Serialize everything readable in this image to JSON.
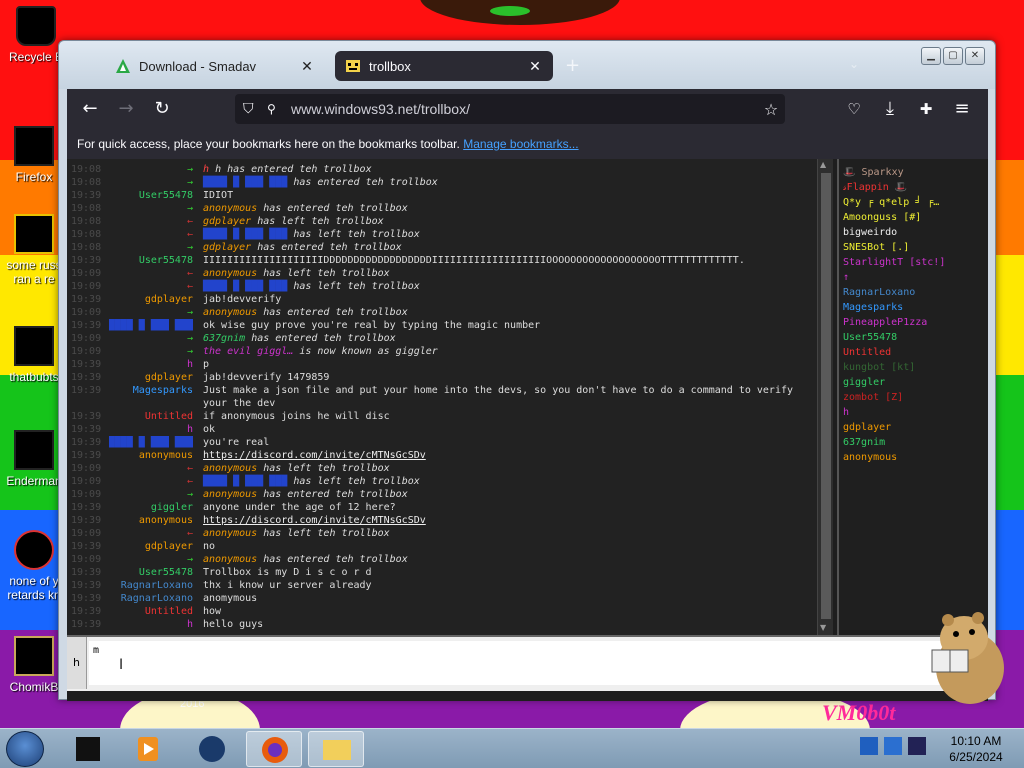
{
  "desktop": {
    "icons": [
      {
        "label": "Recycle B"
      },
      {
        "label": "Firefox"
      },
      {
        "label": "some russ",
        "label2": "ran a re"
      },
      {
        "label": "thatbubts"
      },
      {
        "label": "Enderman"
      },
      {
        "label": "none of y",
        "label2": "retards kn"
      },
      {
        "label": "ChomikB"
      }
    ],
    "bottom_number": "2016",
    "watermark": "VM0b0t"
  },
  "browser": {
    "tabs": [
      {
        "label": "Download - Smadav",
        "icon": "smadav-icon",
        "close": "✕"
      },
      {
        "label": "trollbox",
        "icon": "trollbox-icon",
        "close": "✕"
      }
    ],
    "new_tab": "+",
    "url": "www.windows93.net/trollbox/",
    "bookmarks_text": "For quick access, place your bookmarks here on the bookmarks toolbar.",
    "bookmarks_link": "Manage bookmarks..."
  },
  "trollbox": {
    "messages": [
      {
        "time": "19:08",
        "nick": "→",
        "nick_color": "#3c3",
        "text": "h has entered teh trollbox",
        "text_color": "#ddd",
        "sys": true,
        "prefix": "h",
        "prefix_color": "#f44"
      },
      {
        "time": "19:08",
        "nick": "→",
        "nick_color": "#3c3",
        "text": "has entered teh trollbox",
        "text_color": "#ddd",
        "sys": true,
        "prefix": "████ █ ███ ███",
        "prefix_color": "#24c"
      },
      {
        "time": "19:39",
        "nick": "User55478",
        "nick_color": "#3c6",
        "text": "IDIOT",
        "text_color": "#ddd",
        "sys": false
      },
      {
        "time": "19:08",
        "nick": "→",
        "nick_color": "#3c3",
        "text": "has entered teh trollbox",
        "text_color": "#ddd",
        "sys": true,
        "prefix": "anonymous",
        "prefix_color": "#e90"
      },
      {
        "time": "19:08",
        "nick": "←",
        "nick_color": "#c33",
        "text": "has left teh trollbox",
        "text_color": "#ddd",
        "sys": true,
        "prefix": "gdplayer",
        "prefix_color": "#e90"
      },
      {
        "time": "19:08",
        "nick": "←",
        "nick_color": "#c33",
        "text": "has left teh trollbox",
        "text_color": "#ddd",
        "sys": true,
        "prefix": "████ █ ███ ███",
        "prefix_color": "#24c"
      },
      {
        "time": "19:08",
        "nick": "→",
        "nick_color": "#3c3",
        "text": "has entered teh trollbox",
        "text_color": "#ddd",
        "sys": true,
        "prefix": "gdplayer",
        "prefix_color": "#e90"
      },
      {
        "time": "19:39",
        "nick": "User55478",
        "nick_color": "#3c6",
        "text": "IIIIIIIIIIIIIIIIIIIIDDDDDDDDDDDDDDDDDDIIIIIIIIIIIIIIIIIIIOOOOOOOOOOOOOOOOOOOTTTTTTTTTTTTT.",
        "text_color": "#ddd",
        "sys": false
      },
      {
        "time": "19:09",
        "nick": "←",
        "nick_color": "#c33",
        "text": "has left teh trollbox",
        "text_color": "#ddd",
        "sys": true,
        "prefix": "anonymous",
        "prefix_color": "#e90"
      },
      {
        "time": "19:09",
        "nick": "←",
        "nick_color": "#c33",
        "text": "has left teh trollbox",
        "text_color": "#ddd",
        "sys": true,
        "prefix": "████ █ ███ ███",
        "prefix_color": "#24c"
      },
      {
        "time": "19:39",
        "nick": "gdplayer",
        "nick_color": "#e90",
        "text": "jab!devverify",
        "text_color": "#ddd",
        "sys": false
      },
      {
        "time": "19:09",
        "nick": "→",
        "nick_color": "#3c3",
        "text": "has entered teh trollbox",
        "text_color": "#ddd",
        "sys": true,
        "prefix": "anonymous",
        "prefix_color": "#e90"
      },
      {
        "time": "19:39",
        "nick": "████ █ ███ ███",
        "nick_color": "#24c",
        "text": "ok wise guy prove you're real by typing the magic number",
        "text_color": "#ddd",
        "sys": false
      },
      {
        "time": "19:09",
        "nick": "→",
        "nick_color": "#3c3",
        "text": "has entered teh trollbox",
        "text_color": "#ddd",
        "sys": true,
        "prefix": "637gnim",
        "prefix_color": "#3c6"
      },
      {
        "time": "19:09",
        "nick": "→",
        "nick_color": "#3c3",
        "text": "is now known as giggler",
        "text_color": "#ddd",
        "sys": true,
        "prefix": "the evil giggl…",
        "prefix_color": "#c3c"
      },
      {
        "time": "19:39",
        "nick": "h",
        "nick_color": "#c3c",
        "text": "p",
        "text_color": "#ddd",
        "sys": false
      },
      {
        "time": "19:39",
        "nick": "gdplayer",
        "nick_color": "#e90",
        "text": "jab!devverify 1479859",
        "text_color": "#ddd",
        "sys": false
      },
      {
        "time": "19:39",
        "nick": "Magesparks",
        "nick_color": "#39f",
        "text": "Just make a json file and put your home into the devs, so you don't have to do a command to verify",
        "text_color": "#ddd",
        "sys": false
      },
      {
        "time": "",
        "nick": "",
        "nick_color": "#ddd",
        "text": "your the dev",
        "text_color": "#ddd",
        "sys": false
      },
      {
        "time": "19:39",
        "nick": "Untitled",
        "nick_color": "#e33",
        "text": "if anonymous joins he will disc",
        "text_color": "#ddd",
        "sys": false
      },
      {
        "time": "19:39",
        "nick": "h",
        "nick_color": "#c3c",
        "text": "ok",
        "text_color": "#ddd",
        "sys": false
      },
      {
        "time": "19:39",
        "nick": "████ █ ███ ███",
        "nick_color": "#24c",
        "text": "you're real",
        "text_color": "#ddd",
        "sys": false
      },
      {
        "time": "19:39",
        "nick": "anonymous",
        "nick_color": "#e90",
        "text": "https://discord.com/invite/cMTNsGcSDv",
        "text_color": "#ddd",
        "sys": false,
        "link": true
      },
      {
        "time": "19:09",
        "nick": "←",
        "nick_color": "#c33",
        "text": "has left teh trollbox",
        "text_color": "#ddd",
        "sys": true,
        "prefix": "anonymous",
        "prefix_color": "#e90"
      },
      {
        "time": "19:09",
        "nick": "←",
        "nick_color": "#c33",
        "text": "has left teh trollbox",
        "text_color": "#ddd",
        "sys": true,
        "prefix": "████ █ ███ ███",
        "prefix_color": "#24c"
      },
      {
        "time": "19:09",
        "nick": "→",
        "nick_color": "#3c3",
        "text": "has entered teh trollbox",
        "text_color": "#ddd",
        "sys": true,
        "prefix": "anonymous",
        "prefix_color": "#e90"
      },
      {
        "time": "19:39",
        "nick": "giggler",
        "nick_color": "#3c6",
        "text": "anyone under the age of 12 here?",
        "text_color": "#ddd",
        "sys": false
      },
      {
        "time": "19:39",
        "nick": "anonymous",
        "nick_color": "#e90",
        "text": "https://discord.com/invite/cMTNsGcSDv",
        "text_color": "#ddd",
        "sys": false,
        "link": true
      },
      {
        "time": "19:09",
        "nick": "←",
        "nick_color": "#c33",
        "text": "has left teh trollbox",
        "text_color": "#ddd",
        "sys": true,
        "prefix": "anonymous",
        "prefix_color": "#e90"
      },
      {
        "time": "19:39",
        "nick": "gdplayer",
        "nick_color": "#e90",
        "text": "no",
        "text_color": "#ddd",
        "sys": false
      },
      {
        "time": "19:09",
        "nick": "→",
        "nick_color": "#3c3",
        "text": "has entered teh trollbox",
        "text_color": "#ddd",
        "sys": true,
        "prefix": "anonymous",
        "prefix_color": "#e90"
      },
      {
        "time": "19:39",
        "nick": "User55478",
        "nick_color": "#3c6",
        "text": "Trollbox is my D i s c o r d",
        "text_color": "#ddd",
        "sys": false
      },
      {
        "time": "19:39",
        "nick": "RagnarLoxano",
        "nick_color": "#48c",
        "text": "thx i know ur server already",
        "text_color": "#ddd",
        "sys": false
      },
      {
        "time": "19:39",
        "nick": "RagnarLoxano",
        "nick_color": "#48c",
        "text": "anomymous",
        "text_color": "#ddd",
        "sys": false
      },
      {
        "time": "19:39",
        "nick": "Untitled",
        "nick_color": "#e33",
        "text": "how",
        "text_color": "#ddd",
        "sys": false
      },
      {
        "time": "19:39",
        "nick": "h",
        "nick_color": "#c3c",
        "text": "hello guys",
        "text_color": "#ddd",
        "sys": false
      }
    ],
    "users": [
      {
        "name": "🎩 Sparkxy",
        "color": "#b98"
      },
      {
        "name": "𝓈Flappin 🎩",
        "color": "#e33"
      },
      {
        "name": "Q*y ╒ q*elp ╛ ╒…",
        "color": "#ee3"
      },
      {
        "name": "Amoonguss [#]",
        "color": "#ee3"
      },
      {
        "name": "bigweirdo",
        "color": "#eee"
      },
      {
        "name": "SNESBot [.]",
        "color": "#ee3"
      },
      {
        "name": "StarlightT [stc!]",
        "color": "#c3c"
      },
      {
        "name": "↑",
        "color": "#c3c"
      },
      {
        "name": "RagnarLoxano",
        "color": "#48c"
      },
      {
        "name": "Magesparks",
        "color": "#39f"
      },
      {
        "name": "PineappleP1zza",
        "color": "#c3c"
      },
      {
        "name": "User55478",
        "color": "#3c6"
      },
      {
        "name": "Untitled",
        "color": "#e33"
      },
      {
        "name": "kungbot [kt]",
        "color": "#363"
      },
      {
        "name": "giggler",
        "color": "#3c6"
      },
      {
        "name": "zombot [Z]",
        "color": "#c22"
      },
      {
        "name": "h",
        "color": "#c3c"
      },
      {
        "name": "gdplayer",
        "color": "#e90"
      },
      {
        "name": "637gnim",
        "color": "#3c6"
      },
      {
        "name": "anonymous",
        "color": "#e90"
      }
    ],
    "me_label": "h",
    "input_value": "m"
  },
  "taskbar": {
    "time": "10:10 AM",
    "date": "6/25/2024"
  },
  "colors": {
    "chat_bg": "#222222",
    "timestamp": "#4a4a4a",
    "link": "#45a1ff"
  }
}
